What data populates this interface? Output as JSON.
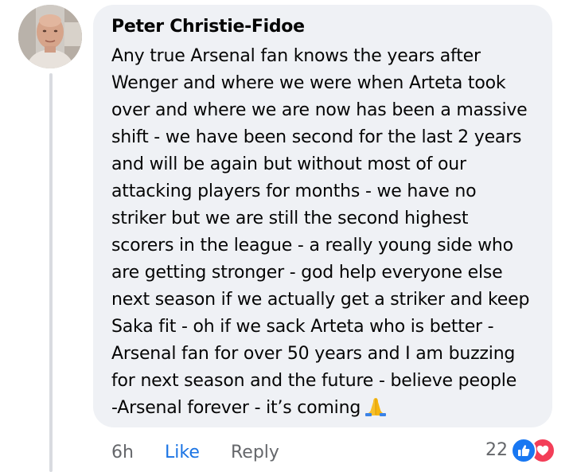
{
  "comment": {
    "author": "Peter Christie-Fidoe",
    "body_lines": [
      "Any true Arsenal fan knows the years after",
      "Wenger and where we were when Arteta took",
      "over and where we are now has been a massive",
      "shift - we have been second for the last 2 years",
      "and will be again but without most of our",
      "attacking players for months - we have no",
      "striker but we are still the second highest",
      "scorers in the league - a really young side who",
      "are getting stronger - god help everyone else",
      "next season if we actually get a striker and keep",
      "Saka fit - oh if we sack Arteta who is better -",
      "Arsenal fan for over 50 years and I am buzzing",
      "for next season and the future - believe people",
      "-Arsenal forever - it’s coming"
    ],
    "trailing_emoji_icon": "folded-hands-icon"
  },
  "actions": {
    "time": "6h",
    "like_label": "Like",
    "reply_label": "Reply"
  },
  "reactions": {
    "count": "22",
    "icons": [
      "like-reaction-icon",
      "love-reaction-icon"
    ]
  },
  "colors": {
    "bubble": "#eff1f5",
    "link": "#1b74e4",
    "secondary_text": "#65676b",
    "like_blue": "#1877f2",
    "love_red": "#f33e58",
    "thread_line": "#d9dbe0"
  }
}
